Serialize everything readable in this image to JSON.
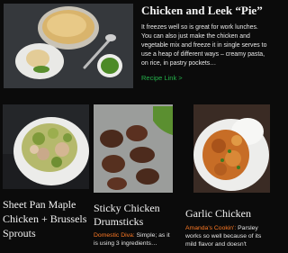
{
  "featured": {
    "title": "Chicken and Leek “Pie”",
    "description": "It freezes well so is great for work lunches. You can also just make the chicken and vegetable mix and freeze it in single serves to use a heap of different ways – creamy pasta, on rice, in pastry pockets…",
    "link_label": "Recipe Link >"
  },
  "cards": [
    {
      "title": "Sheet Pan Maple Chicken + Brussels Sprouts"
    },
    {
      "title": "Sticky Chicken Drumsticks",
      "source": "Domestic Diva:",
      "excerpt": " Simple; as it is using 3 ingredients…"
    },
    {
      "title": "Garlic Chicken",
      "source": "Amanda's Cookin':",
      "excerpt": " Parsley works so well because of its mild flavor and doesn't"
    }
  ],
  "colors": {
    "background": "#0b0b0b",
    "link": "#24b04a",
    "source": "#ff7a24"
  }
}
